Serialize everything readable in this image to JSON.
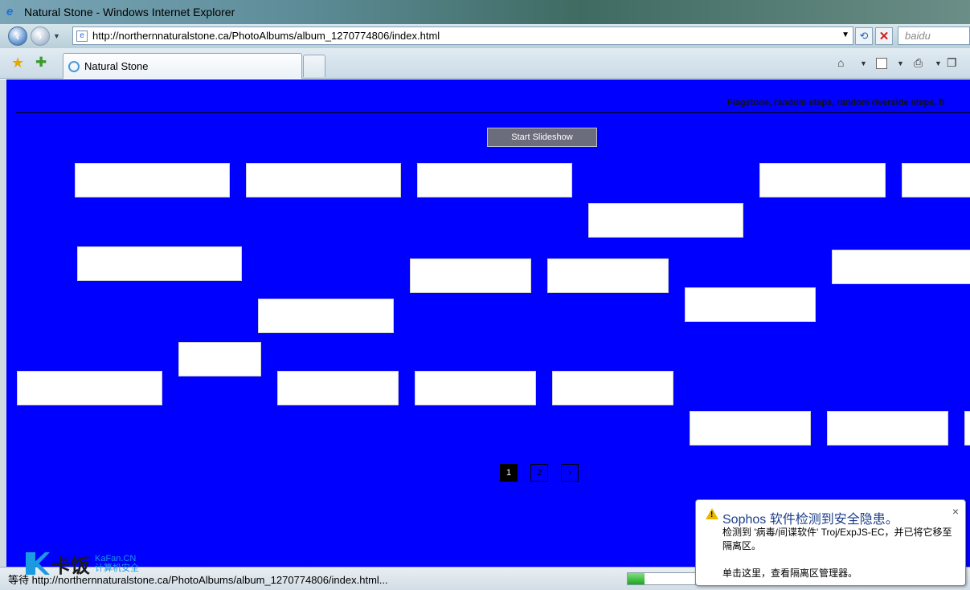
{
  "window": {
    "title": "Natural Stone - Windows Internet Explorer"
  },
  "address": {
    "url": "http://northernnaturalstone.ca/PhotoAlbums/album_1270774806/index.html",
    "search_placeholder": "baidu"
  },
  "tabs": [
    {
      "label": "Natural Stone"
    }
  ],
  "content": {
    "caption": "Flagstone, random steps, random riverside steps, fl",
    "slideshow_label": "Start Slideshow",
    "pages": [
      "1",
      "2",
      "›"
    ],
    "active_page": "1",
    "background_color": "#0000fe"
  },
  "status": {
    "text": "等待 http://northernnaturalstone.ca/PhotoAlbums/album_1270774806/index.html...",
    "progress": 0.25
  },
  "watermark": {
    "main": "卡饭",
    "sub1": "KaFan.CN",
    "sub2": "计算机安全"
  },
  "popup": {
    "title": "Sophos 软件检测到安全隐患。",
    "body": "检测到 '病毒/间谍软件' Troj/ExpJS-EC，并已将它移至隔离区。",
    "link": "单击这里，查看隔离区管理器。"
  }
}
